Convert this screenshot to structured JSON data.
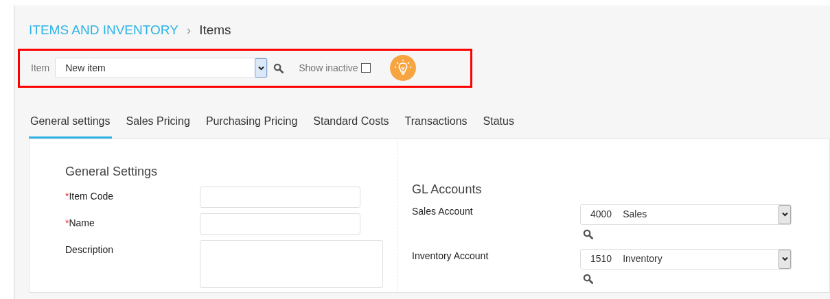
{
  "breadcrumb": {
    "section": "ITEMS AND INVENTORY",
    "separator": "›",
    "current": "Items"
  },
  "toolbar": {
    "item_label": "Item",
    "item_value": "New item",
    "show_inactive_label": "Show inactive",
    "show_inactive_checked": false,
    "highlighted": true
  },
  "tabs": [
    {
      "label": "General settings",
      "selected": true
    },
    {
      "label": "Sales Pricing",
      "selected": false
    },
    {
      "label": "Purchasing Pricing",
      "selected": false
    },
    {
      "label": "Standard Costs",
      "selected": false
    },
    {
      "label": "Transactions",
      "selected": false
    },
    {
      "label": "Status",
      "selected": false
    }
  ],
  "general_settings": {
    "title": "General Settings",
    "fields": [
      {
        "label": "Item Code",
        "required_mark": "*",
        "kind": "text"
      },
      {
        "label": "Name",
        "required_mark": "*",
        "kind": "text"
      },
      {
        "label": "Description",
        "kind": "textarea"
      }
    ]
  },
  "gl_accounts": {
    "title": "GL Accounts",
    "fields": [
      {
        "label": "Sales Account",
        "code": "4000",
        "name": "Sales"
      },
      {
        "label": "Inventory Account",
        "code": "1510",
        "name": "Inventory"
      }
    ]
  }
}
